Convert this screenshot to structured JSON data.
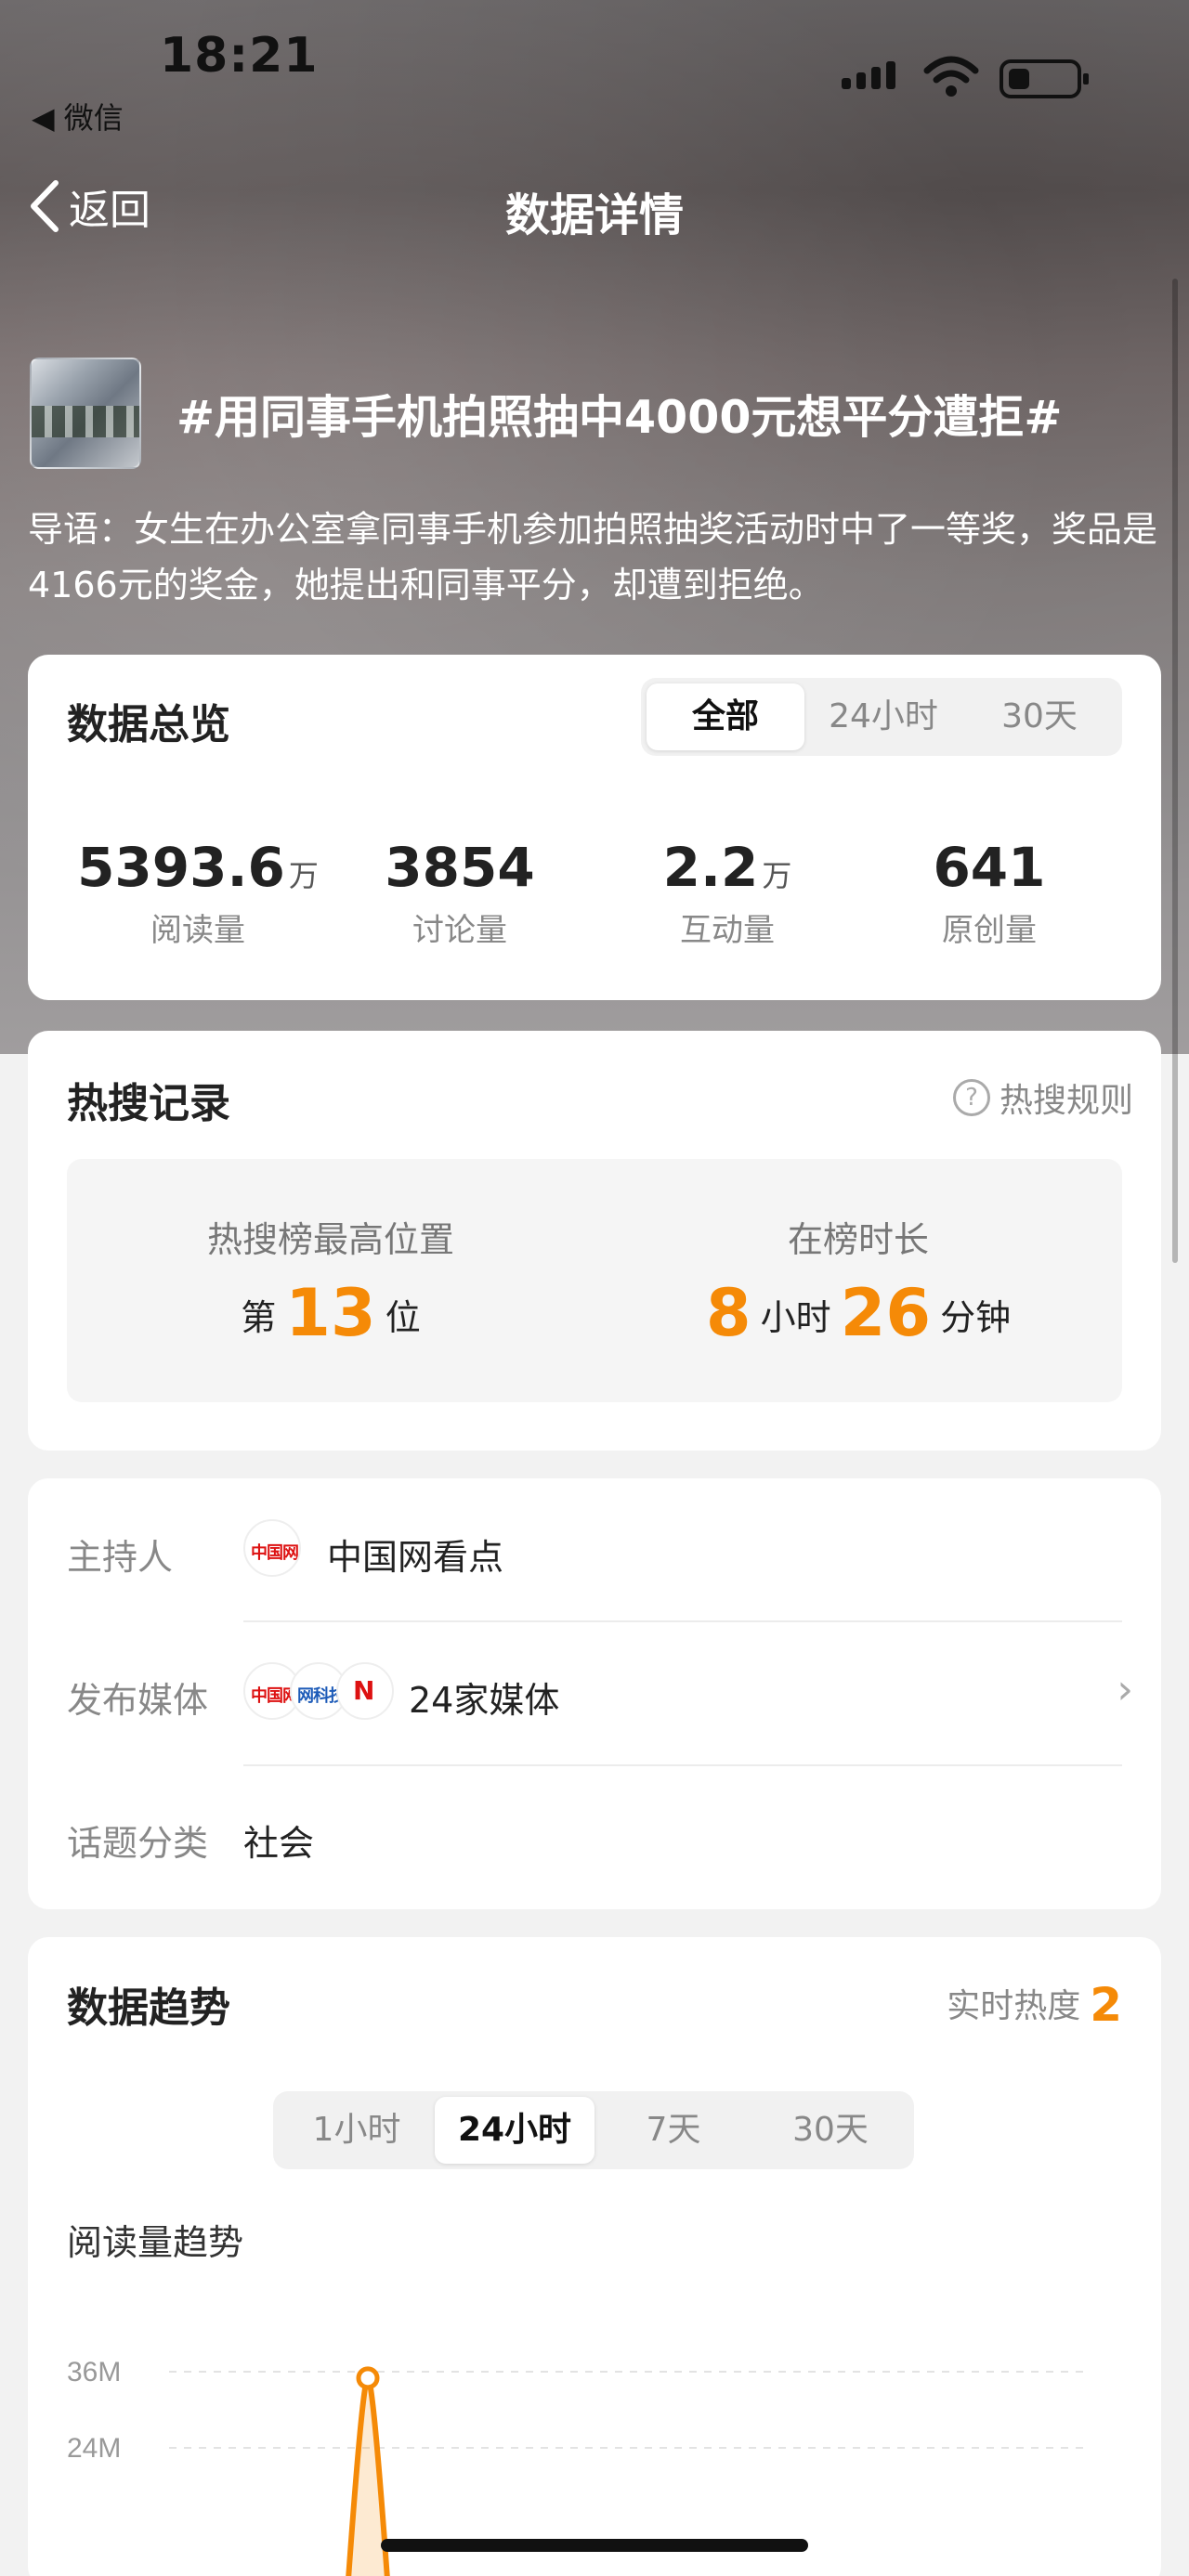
{
  "status_bar": {
    "time": "18:21",
    "back_app": "◀ 微信"
  },
  "nav": {
    "back_label": "返回",
    "title": "数据详情"
  },
  "topic": {
    "title": "#用同事手机拍照抽中4000元想平分遭拒#",
    "intro": "导语：女生在办公室拿同事手机参加拍照抽奖活动时中了一等奖，奖品是4166元的奖金，她提出和同事平分，却遭到拒绝。"
  },
  "overview": {
    "title": "数据总览",
    "tabs": [
      "全部",
      "24小时",
      "30天"
    ],
    "active_tab": "全部",
    "stats": [
      {
        "value": "5393.6",
        "unit": "万",
        "label": "阅读量"
      },
      {
        "value": "3854",
        "unit": "",
        "label": "讨论量"
      },
      {
        "value": "2.2",
        "unit": "万",
        "label": "互动量"
      },
      {
        "value": "641",
        "unit": "",
        "label": "原创量"
      }
    ]
  },
  "hot_record": {
    "title": "热搜记录",
    "rule_label": "热搜规则",
    "highest_caption": "热搜榜最高位置",
    "rank_prefix": "第",
    "rank": "13",
    "rank_suffix": "位",
    "duration_caption": "在榜时长",
    "hours": "8",
    "hours_unit": "小时",
    "minutes": "26",
    "minutes_unit": "分钟"
  },
  "info": {
    "host_label": "主持人",
    "host_name": "中国网看点",
    "media_label": "发布媒体",
    "media_value": "24家媒体",
    "category_label": "话题分类",
    "category_value": "社会",
    "logo_text_1": "中国网",
    "logo_text_2": "网科技",
    "logo_text_3": "N"
  },
  "trend": {
    "title": "数据趋势",
    "heat_label": "实时热度",
    "heat_value": "2",
    "tabs": [
      "1小时",
      "24小时",
      "7天",
      "30天"
    ],
    "active_tab": "24小时",
    "chart_title": "阅读量趋势"
  },
  "colors": {
    "accent": "#f58a07"
  },
  "chart_data": {
    "type": "line",
    "title": "阅读量趋势",
    "yticks": [
      "36M",
      "24M"
    ],
    "ylim": [
      24,
      36
    ],
    "series": [
      {
        "x": [
          0,
          1,
          2
        ],
        "values": [
          0,
          35,
          0
        ]
      }
    ]
  }
}
